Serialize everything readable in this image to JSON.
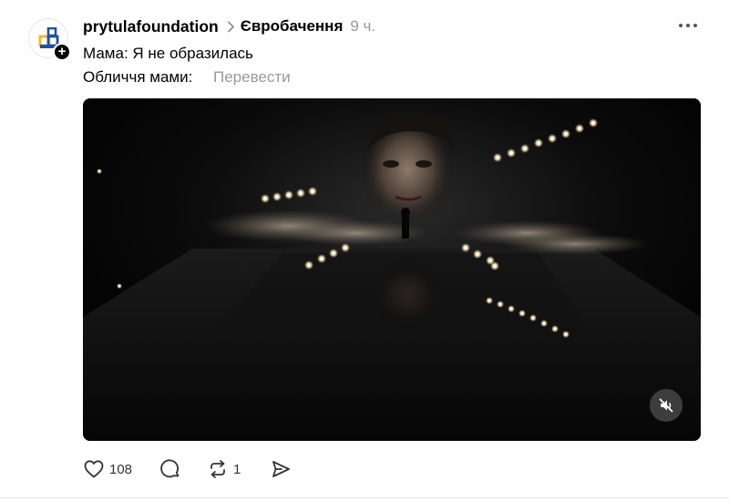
{
  "post": {
    "username": "prytulafoundation",
    "tag": "Євробачення",
    "time": "9 ч.",
    "line1": "Мама: Я не образилась",
    "line2": "Обличчя мами:",
    "translate_label": "Перевести",
    "follow_glyph": "+"
  },
  "actions": {
    "likes": "108",
    "reposts": "1"
  },
  "icons": {
    "avatar": "prytula-foundation-logo",
    "follow": "plus-icon",
    "breadcrumb": "chevron-right-icon",
    "more": "more-horizontal-icon",
    "mute": "speaker-muted-icon",
    "like": "heart-icon",
    "comment": "comment-bubble-icon",
    "repost": "repost-icon",
    "share": "send-icon"
  },
  "colors": {
    "text": "#000000",
    "muted": "#999999",
    "logo_blue": "#1f4fa8",
    "logo_yellow": "#f3b51c"
  }
}
